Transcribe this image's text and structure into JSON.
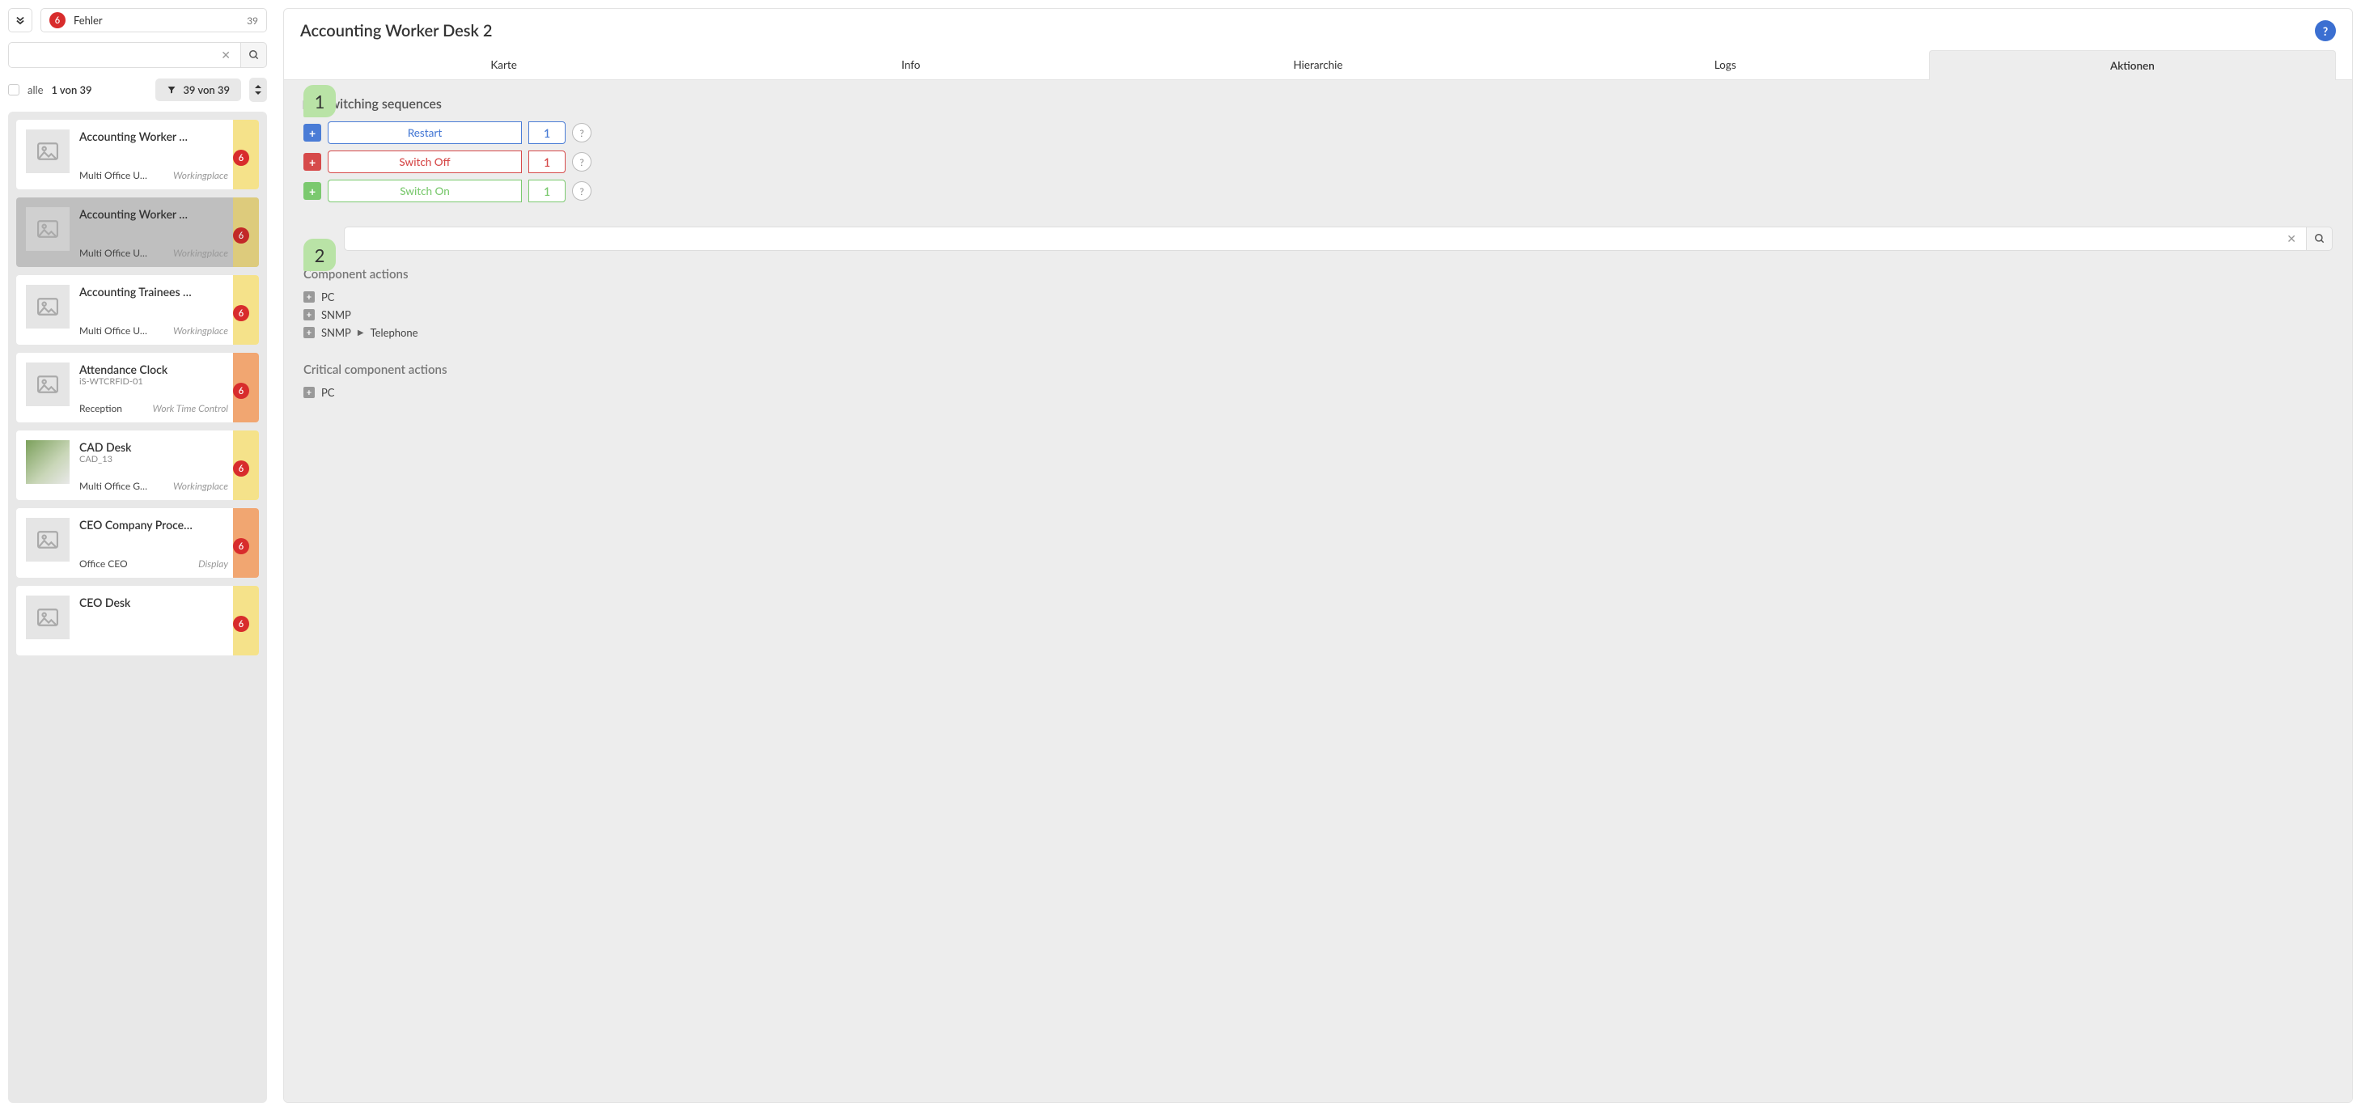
{
  "sidebar": {
    "status": {
      "badge": "6",
      "label": "Fehler",
      "count": "39"
    },
    "search": {
      "value": ""
    },
    "filter": {
      "alle": "alle",
      "pager": "1 von 39",
      "filterLabel": "39 von 39"
    },
    "items": [
      {
        "title": "Accounting Worker …",
        "sub": "",
        "loc": "Multi Office U…",
        "type": "Workingplace",
        "badge": "6",
        "stripe": "yellow",
        "thumb": "placeholder",
        "selected": false
      },
      {
        "title": "Accounting Worker …",
        "sub": "",
        "loc": "Multi Office U…",
        "type": "Workingplace",
        "badge": "6",
        "stripe": "yellow",
        "thumb": "placeholder",
        "selected": true
      },
      {
        "title": "Accounting Trainees …",
        "sub": "",
        "loc": "Multi Office U…",
        "type": "Workingplace",
        "badge": "6",
        "stripe": "yellow",
        "thumb": "placeholder",
        "selected": false
      },
      {
        "title": "Attendance Clock",
        "sub": "iS-WTCRFID-01",
        "loc": "Reception",
        "type": "Work Time Control",
        "badge": "6",
        "stripe": "orange",
        "thumb": "placeholder",
        "selected": false
      },
      {
        "title": "CAD Desk",
        "sub": "CAD_13",
        "loc": "Multi Office G…",
        "type": "Workingplace",
        "badge": "6",
        "stripe": "yellow",
        "thumb": "photo",
        "selected": false
      },
      {
        "title": "CEO Company Proce…",
        "sub": "",
        "loc": "Office CEO",
        "type": "Display",
        "badge": "6",
        "stripe": "orange",
        "thumb": "placeholder",
        "selected": false
      },
      {
        "title": "CEO Desk",
        "sub": "",
        "loc": "",
        "type": "",
        "badge": "6",
        "stripe": "yellow",
        "thumb": "placeholder",
        "selected": false
      }
    ]
  },
  "main": {
    "title": "Accounting Worker Desk 2",
    "tabs": [
      "Karte",
      "Info",
      "Hierarchie",
      "Logs",
      "Aktionen"
    ],
    "activeTab": 4,
    "callouts": {
      "one": "1",
      "two": "2"
    },
    "sections": {
      "switching": {
        "title": "Switching sequences",
        "rows": [
          {
            "label": "Restart",
            "count": "1",
            "color": "blue"
          },
          {
            "label": "Switch Off",
            "count": "1",
            "color": "red"
          },
          {
            "label": "Switch On",
            "count": "1",
            "color": "green"
          }
        ]
      },
      "miniSearch": {
        "value": ""
      },
      "componentActions": {
        "title": "Component actions",
        "items": [
          {
            "parts": [
              "PC"
            ]
          },
          {
            "parts": [
              "SNMP"
            ]
          },
          {
            "parts": [
              "SNMP",
              "Telephone"
            ]
          }
        ]
      },
      "criticalActions": {
        "title": "Critical component actions",
        "items": [
          {
            "parts": [
              "PC"
            ]
          }
        ]
      }
    }
  },
  "helpGlyph": "?"
}
